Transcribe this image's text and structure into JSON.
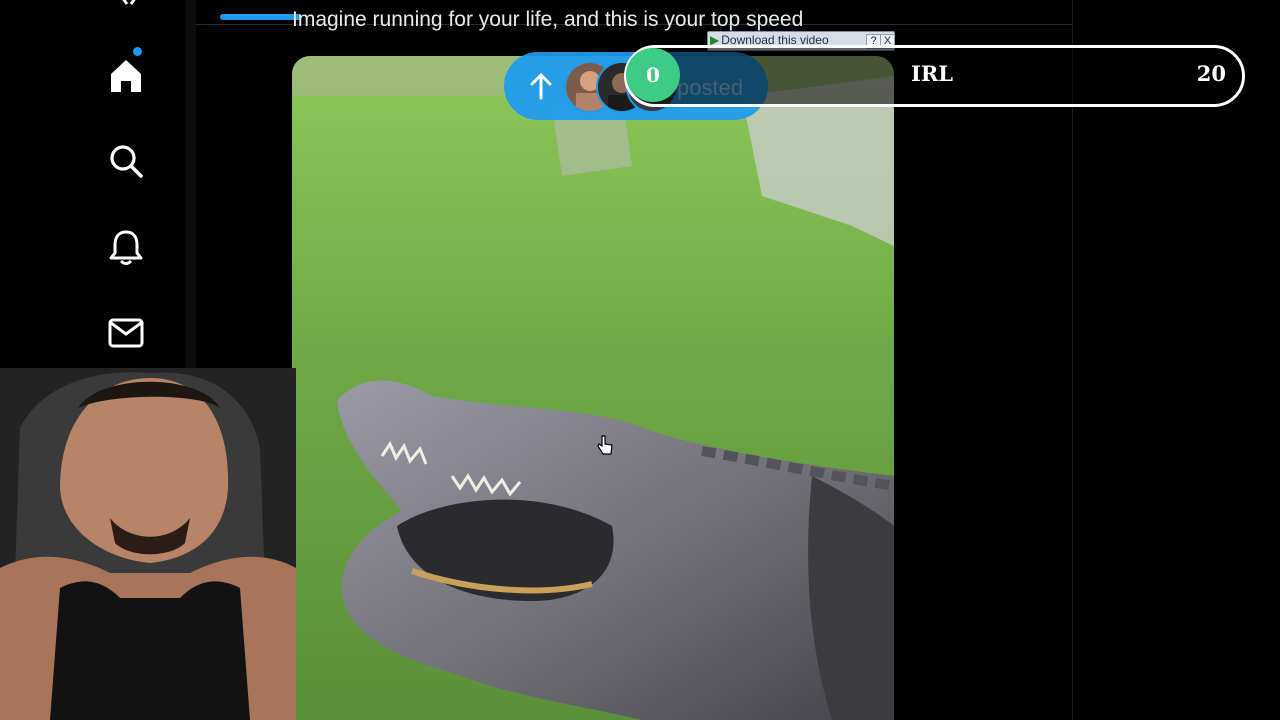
{
  "sidebar": {
    "items": [
      {
        "icon": "home-icon",
        "label": "Home",
        "has_notification": true
      },
      {
        "icon": "search-icon",
        "label": "Search"
      },
      {
        "icon": "bell-icon",
        "label": "Notifications"
      },
      {
        "icon": "mail-icon",
        "label": "Messages"
      }
    ]
  },
  "post": {
    "text": "Imagine running for your life, and this is your top speed"
  },
  "new_posts_pill": {
    "label": "posted",
    "icon": "arrow-up-icon"
  },
  "download_toolbar": {
    "button_label": "Download this video",
    "help_label": "?",
    "close_label": "X"
  },
  "irl_overlay": {
    "circle_value": "0",
    "label": "IRL",
    "count": "20",
    "accent": "#3ecb86"
  },
  "colors": {
    "accent": "#1d9bf0",
    "background": "#000000"
  }
}
